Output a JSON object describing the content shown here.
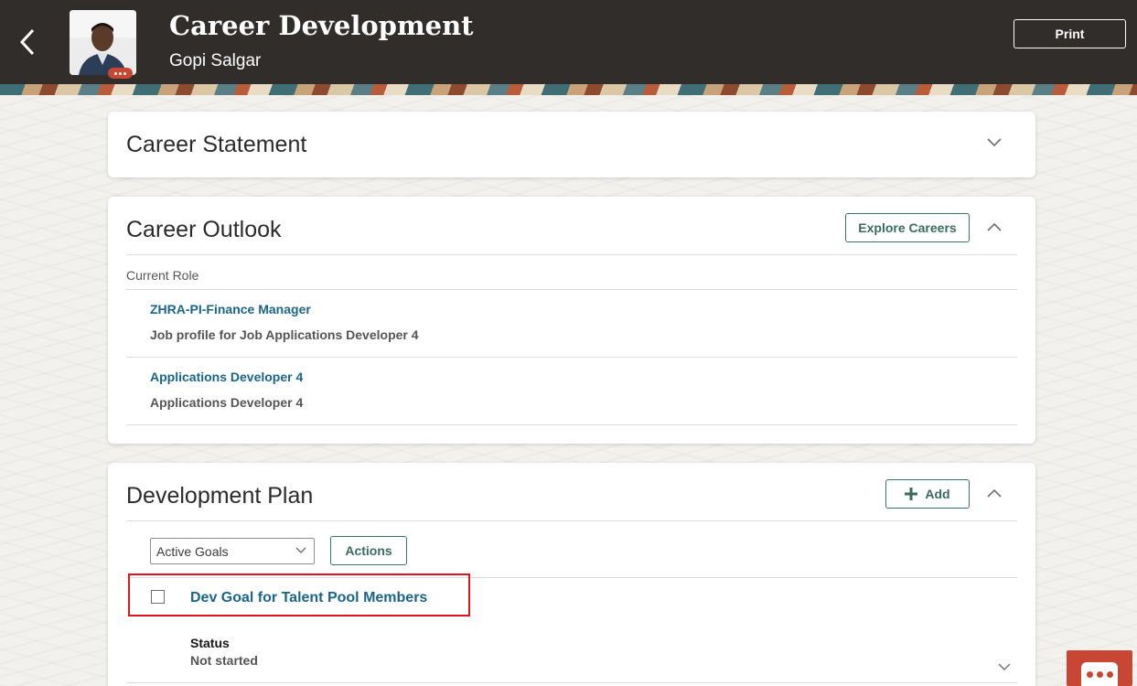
{
  "header": {
    "title": "Career Development",
    "subtitle": "Gopi Salgar",
    "print_label": "Print"
  },
  "career_statement": {
    "title": "Career Statement"
  },
  "career_outlook": {
    "title": "Career Outlook",
    "explore_label": "Explore Careers",
    "current_role_label": "Current Role",
    "roles": [
      {
        "name": "ZHRA-PI-Finance Manager",
        "description": "Job profile for Job Applications Developer 4"
      },
      {
        "name": "Applications Developer 4",
        "description": "Applications Developer 4"
      }
    ]
  },
  "development_plan": {
    "title": "Development Plan",
    "add_label": "Add",
    "filter_selected": "Active Goals",
    "actions_label": "Actions",
    "goal": {
      "name": "Dev Goal for Talent Pool Members",
      "status_label": "Status",
      "status_value": "Not started"
    }
  },
  "colors": {
    "header_bg": "#312d2a",
    "link": "#1a6589",
    "button_border": "#3a7263",
    "highlight": "#e0141e",
    "chat_accent": "#c74634"
  },
  "icons": [
    "back-arrow-icon",
    "chevron-down-icon",
    "chevron-up-icon",
    "plus-icon",
    "chat-icon",
    "more-dots-icon"
  ]
}
